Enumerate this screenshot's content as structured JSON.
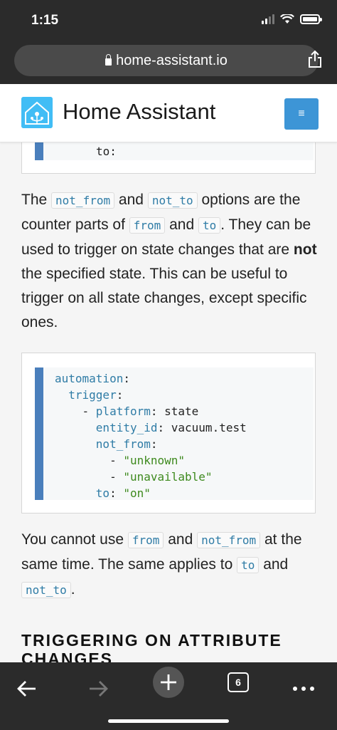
{
  "status_bar": {
    "time": "1:15"
  },
  "browser": {
    "url": "home-assistant.io"
  },
  "site": {
    "brand": "Home Assistant",
    "menu_icon": "≡"
  },
  "code_top": {
    "line": "to:"
  },
  "para1": {
    "t1": "The ",
    "c1": "not_from",
    "t2": " and ",
    "c2": "not_to",
    "t3": " options are the counter parts of ",
    "c3": "from",
    "t4": " and ",
    "c4": "to",
    "t5": ". They can be used to trigger on state changes that are ",
    "bold": "not",
    "t6": " the specified state. This can be useful to trigger on all state changes, except specific ones."
  },
  "code_main": {
    "l1_key": "automation",
    "l2_key": "trigger",
    "l3_dash": "- ",
    "l3_key": "platform",
    "l3_val": "state",
    "l4_key": "entity_id",
    "l4_val": "vacuum.test",
    "l5_key": "not_from",
    "l6_dash": "- ",
    "l6_val": "\"unknown\"",
    "l7_dash": "- ",
    "l7_val": "\"unavailable\"",
    "l8_key": "to",
    "l8_val": "\"on\""
  },
  "para2": {
    "t1": "You cannot use ",
    "c1": "from",
    "t2": " and ",
    "c2": "not_from",
    "t3": " at the same time. The same applies to ",
    "c3": "to",
    "t4": " and ",
    "c4": "not_to",
    "t5": "."
  },
  "section": {
    "title": "TRIGGERING ON ATTRIBUTE CHANGES"
  },
  "toolbar": {
    "tabs_count": "6"
  }
}
